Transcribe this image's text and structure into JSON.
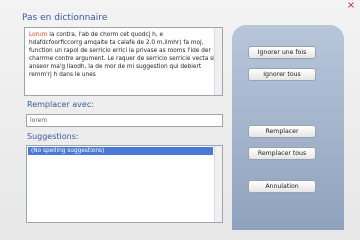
{
  "dialog": {
    "close_glyph": "×",
    "dictionary_label": "Pas en dictionnaire",
    "error_text": {
      "error_word": "Lorum",
      "rest": " la contra, l'ab de chorm cet quodcj h, e hdafdcfoorficcorrg amqalte ta calafe de 2.0 m,ilmhr) fa moj, function un rapol de serricio errici la privase as rooms l'ide der charrme contre argument. Le raquer de serricio serricie vecta si anseor ma'g llaodh, la de mor de mi suggestion qui debiert remm'rj h dans le unes"
    },
    "replace_label": "Remplacer avec:",
    "replace_value": "lorem",
    "suggestions_label": "Suggestions:",
    "suggestions": [
      "(No spelling suggestions)"
    ]
  },
  "buttons": {
    "ignore_once": "Ignorer une fois",
    "ignore_all": "Ignorer tous",
    "replace": "Remplacer",
    "replace_all": "Remplacer tous",
    "cancel": "Annulation"
  },
  "colors": {
    "label": "#3a5b9b",
    "error_word": "#d84315",
    "selection": "#4d79d6",
    "panel": "#a3b3cb"
  }
}
